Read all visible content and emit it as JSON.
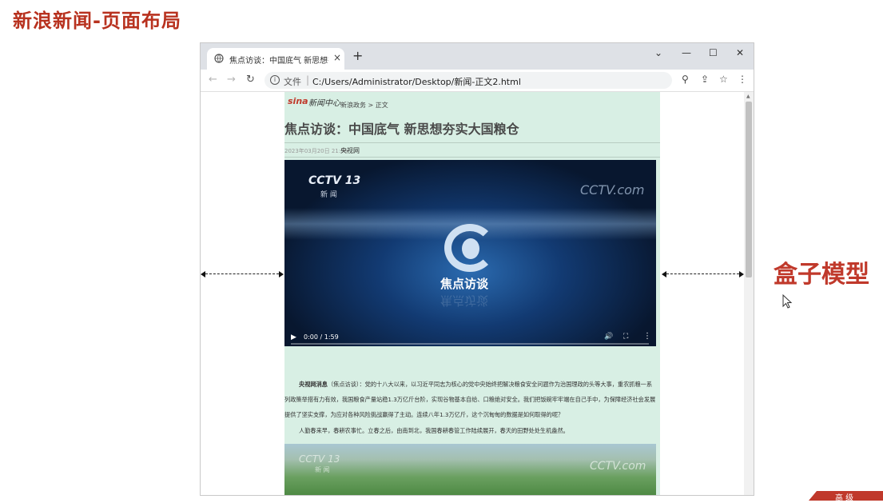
{
  "slide": {
    "title": "新浪新闻-页面布局",
    "side_label": "盒子模型",
    "corner_text": "高 级"
  },
  "browser": {
    "tab_title": "焦点访谈：中国底气 新思想夯实",
    "new_tab": "+",
    "close_tab": "×",
    "window_controls": {
      "minimize": "—",
      "maximize": "☐",
      "close": "✕",
      "chevron": "⌄"
    },
    "nav": {
      "back": "←",
      "forward": "→",
      "reload": "↻"
    },
    "address_scheme": "文件",
    "address_url": "C:/Users/Administrator/Desktop/新闻-正文2.html",
    "tools": {
      "zoom": "⚲",
      "share": "⇪",
      "bookmark": "☆",
      "menu": "⋮"
    }
  },
  "page": {
    "logo": "sina",
    "logo_sub": "新闻中心",
    "breadcrumb": "新浪政务 > 正文",
    "article_title": "焦点访谈：中国底气 新思想夯实大国粮仓",
    "meta_time": "2023年03月20日 21:50",
    "meta_source": "央视网",
    "video": {
      "channel": "CCTV 13",
      "channel_sub": "新 闻",
      "watermark": "CCTV.com",
      "show_name": "焦点访谈",
      "time": "0:00 / 1:59"
    },
    "para1_lead": "央视网消息",
    "para1_body": "（焦点访谈）：党的十八大以来，以习近平同志为核心的党中央始终把解决粮食安全问题作为治国理政的头等大事，重农抓粮一系列政策举措有力有效，我国粮食产量站稳1.3万亿斤台阶，实现谷物基本自给、口粮绝对安全。我们把饭碗牢牢端在自己手中，为保障经济社会发展提供了坚实支撑，为应对各种风险挑战赢得了主动。连续八年1.3万亿斤，这个沉甸甸的数据是如何取得的呢？",
    "para2": "人勤春来早，春耕农事忙。立春之后，由南到北，我国春耕春管工作陆续展开，春天的田野处处生机盎然。",
    "image2": {
      "channel": "CCTV 13",
      "channel_sub": "新 闻",
      "watermark": "CCTV.com"
    }
  },
  "colors": {
    "accent": "#c0392b",
    "content_bg": "#d8efe4"
  }
}
